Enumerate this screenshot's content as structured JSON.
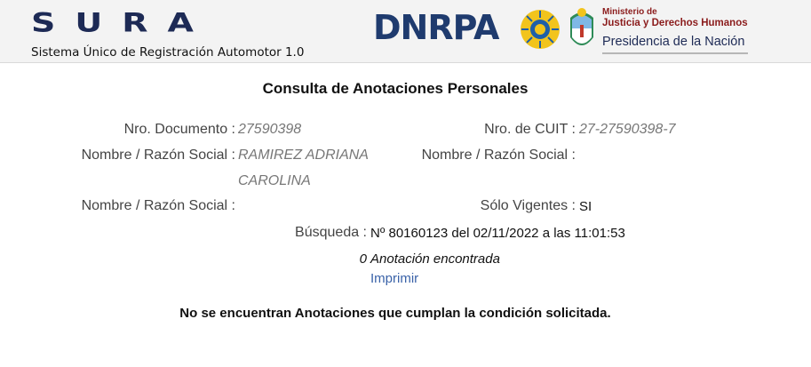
{
  "header": {
    "logo_text": "SURA",
    "subtitle": "Sistema Único de Registración Automotor 1.0",
    "dnrpa_text": "DNRPA",
    "ministerio_line1": "Ministerio de",
    "ministerio_line2": "Justicia y Derechos Humanos",
    "ministerio_line3": "Presidencia de la Nación"
  },
  "page": {
    "title": "Consulta de Anotaciones Personales"
  },
  "fields": {
    "nro_documento_label": "Nro. Documento :",
    "nro_documento_value": "27590398",
    "nro_cuit_label": "Nro. de CUIT :",
    "nro_cuit_value": "27-27590398-7",
    "nombre1_label": "Nombre / Razón Social :",
    "nombre1_value_line1": "RAMIREZ ADRIANA",
    "nombre1_value_line2": "CAROLINA",
    "nombre2_label": "Nombre / Razón Social :",
    "nombre2_value": "",
    "nombre3_label": "Nombre / Razón Social :",
    "nombre3_value": "",
    "solo_vigentes_label": "Sólo Vigentes :",
    "solo_vigentes_value": "SI",
    "busqueda_label": "Búsqueda :",
    "busqueda_value": "Nº 80160123 del 02/11/2022 a las 11:01:53"
  },
  "results": {
    "count": "0",
    "count_label": "Anotación encontrada",
    "print_link": "Imprimir",
    "notice": "No se encuentran Anotaciones que cumplan la condición solicitada."
  },
  "colors": {
    "header_bg": "#f3f3f3",
    "brand_navy": "#1d2a55",
    "dnrpa_blue": "#1f3b6e",
    "link_blue": "#3a62a8",
    "ministerio_red": "#8b1c1c"
  },
  "icons": [
    "sun-emblem-icon",
    "coat-of-arms-icon"
  ]
}
